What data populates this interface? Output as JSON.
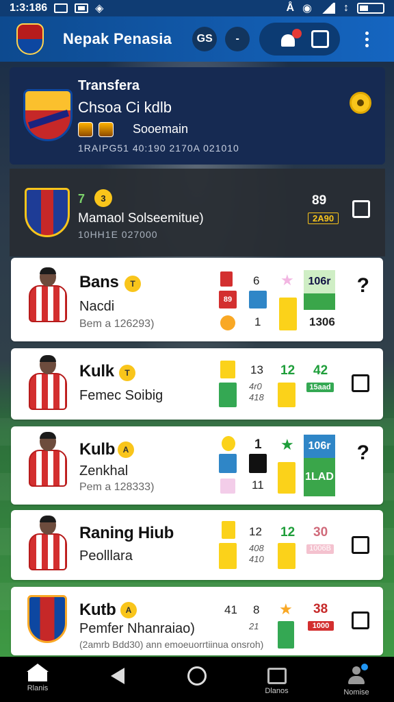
{
  "status_bar": {
    "time": "1:3:186"
  },
  "app_bar": {
    "title": "Nepak Penasia",
    "btn1": "GS",
    "btn2": "-"
  },
  "hero": {
    "title1": "Transfera",
    "title2": "Chsoa Ci kdlb",
    "subtitle": "Sooemain",
    "meta": "1RAIPG51 40:190 2170A 021010"
  },
  "match": {
    "number": "7",
    "coin": "3",
    "name": "Mamaol Solseemitue)",
    "meta": "10HH1E 027000",
    "score": "89",
    "tag": "2A90"
  },
  "players": [
    {
      "name": "Bans",
      "coin": "T",
      "line2": "Nacdi",
      "line3": "Bem a 126293)",
      "stats": {
        "a": "6",
        "b": "1",
        "tile_top": "106r",
        "tile_val": "1306",
        "r1": "89"
      }
    },
    {
      "name": "Kulk",
      "coin": "T",
      "line2": "Femec Soibig",
      "line3": "",
      "stats": {
        "a": "13",
        "b": "4r0",
        "c": "418",
        "d": "12",
        "e": "42",
        "tag": "15aad"
      }
    },
    {
      "name": "Kulb",
      "coin": "A",
      "line2": "Zenkhal",
      "line3": "Pem a 128333)",
      "stats": {
        "a": "1",
        "b": "11",
        "tile_top": "106r",
        "tile_val": "1LAD"
      }
    },
    {
      "name": "Raning Hiub",
      "coin": "",
      "line2": "Peolllara",
      "line3": "",
      "stats": {
        "a": "12",
        "b": "408",
        "c": "410",
        "d": "12",
        "e": "30",
        "tag": "1006B"
      }
    },
    {
      "name": "Kutb",
      "coin": "A",
      "line2": "Pemfer Nhanraiao)",
      "line3": "(2amrb Bdd30) ann emoeuorrtiinua onsroh)",
      "stats": {
        "a": "41",
        "b": "8",
        "c": "21",
        "d": "38",
        "tag": "1000"
      }
    }
  ],
  "bottom_nav": {
    "home": "Rlanis",
    "recent": "Dlanos",
    "profile": "Nomise"
  },
  "colors": {
    "app_bar": "#1565c0",
    "hero_bg": "#162a52",
    "accent_yellow": "#f9c51b",
    "accent_green": "#34a853"
  },
  "icons": [
    "bell-icon",
    "note-icon",
    "kebab-icon",
    "home-icon",
    "back-icon",
    "circle-icon",
    "square-icon",
    "person-icon"
  ]
}
